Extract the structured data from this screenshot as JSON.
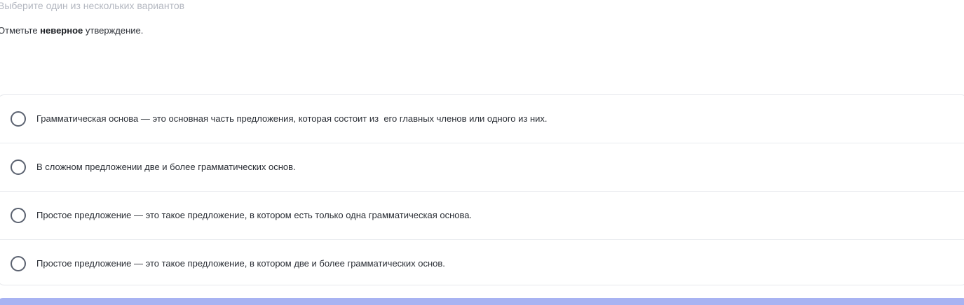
{
  "question": {
    "hint": "Выберите один из нескольких вариантов",
    "prompt_before": "Отметьте ",
    "prompt_bold": "неверное",
    "prompt_after": " утверждение."
  },
  "options": [
    {
      "label": "Грамматическая основа — это основная часть предложения, которая состоит из  его главных членов или одного из них.",
      "selected": false
    },
    {
      "label": "В сложном предложении две и более грамматических основ.",
      "selected": false
    },
    {
      "label": "Простое предложение — это такое предложение, в котором есть только одна грамматическая основа.",
      "selected": false
    },
    {
      "label": "Простое предложение — это такое предложение, в котором две и более грамматических основ.",
      "selected": false
    }
  ],
  "colors": {
    "accent": "#a8b3f2",
    "hint_text": "#b3b7c0",
    "border": "#e6e8ec"
  }
}
